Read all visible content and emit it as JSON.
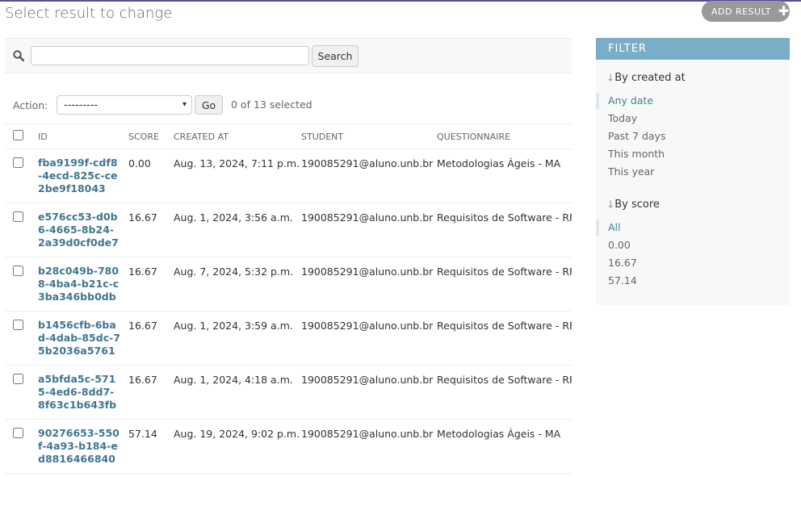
{
  "page": {
    "title": "Select result to change",
    "accent": "#79aec8",
    "link_color": "#417690"
  },
  "header": {
    "add_label": "ADD RESULT",
    "add_icon": "plus-icon"
  },
  "search": {
    "placeholder": "",
    "value": "",
    "button_label": "Search",
    "icon": "search-icon"
  },
  "actions": {
    "label": "Action:",
    "selected_option": "---------",
    "go_label": "Go",
    "selection_text": "0 of 13 selected"
  },
  "table": {
    "columns": [
      "ID",
      "SCORE",
      "CREATED AT",
      "STUDENT",
      "QUESTIONNAIRE"
    ],
    "rows": [
      {
        "id": "fba9199f-cdf8-4ecd-825c-ce2be9f18043",
        "score": "0.00",
        "created_at": "Aug. 13, 2024, 7:11 p.m.",
        "student": "190085291@aluno.unb.br",
        "questionnaire": "Metodologias Ágeis - MA"
      },
      {
        "id": "e576cc53-d0b6-4665-8b24-2a39d0cf0de7",
        "score": "16.67",
        "created_at": "Aug. 1, 2024, 3:56 a.m.",
        "student": "190085291@aluno.unb.br",
        "questionnaire": "Requisitos de Software - RFN"
      },
      {
        "id": "b28c049b-7808-4ba4-b21c-c3ba346bb0db",
        "score": "16.67",
        "created_at": "Aug. 7, 2024, 5:32 p.m.",
        "student": "190085291@aluno.unb.br",
        "questionnaire": "Requisitos de Software - RFN"
      },
      {
        "id": "b1456cfb-6bad-4dab-85dc-75b2036a5761",
        "score": "16.67",
        "created_at": "Aug. 1, 2024, 3:59 a.m.",
        "student": "190085291@aluno.unb.br",
        "questionnaire": "Requisitos de Software - RFN"
      },
      {
        "id": "a5bfda5c-5715-4ed6-8dd7-8f63c1b643fb",
        "score": "16.67",
        "created_at": "Aug. 1, 2024, 4:18 a.m.",
        "student": "190085291@aluno.unb.br",
        "questionnaire": "Requisitos de Software - RFN"
      },
      {
        "id": "90276653-550f-4a93-b184-ed8816466840",
        "score": "57.14",
        "created_at": "Aug. 19, 2024, 9:02 p.m.",
        "student": "190085291@aluno.unb.br",
        "questionnaire": "Metodologias Ágeis - MA"
      }
    ]
  },
  "filter": {
    "title": "FILTER",
    "groups": [
      {
        "title": "By created at",
        "items": [
          "Any date",
          "Today",
          "Past 7 days",
          "This month",
          "This year"
        ],
        "selected": "Any date"
      },
      {
        "title": "By score",
        "items": [
          "All",
          "0.00",
          "16.67",
          "57.14"
        ],
        "selected": "All"
      }
    ]
  }
}
